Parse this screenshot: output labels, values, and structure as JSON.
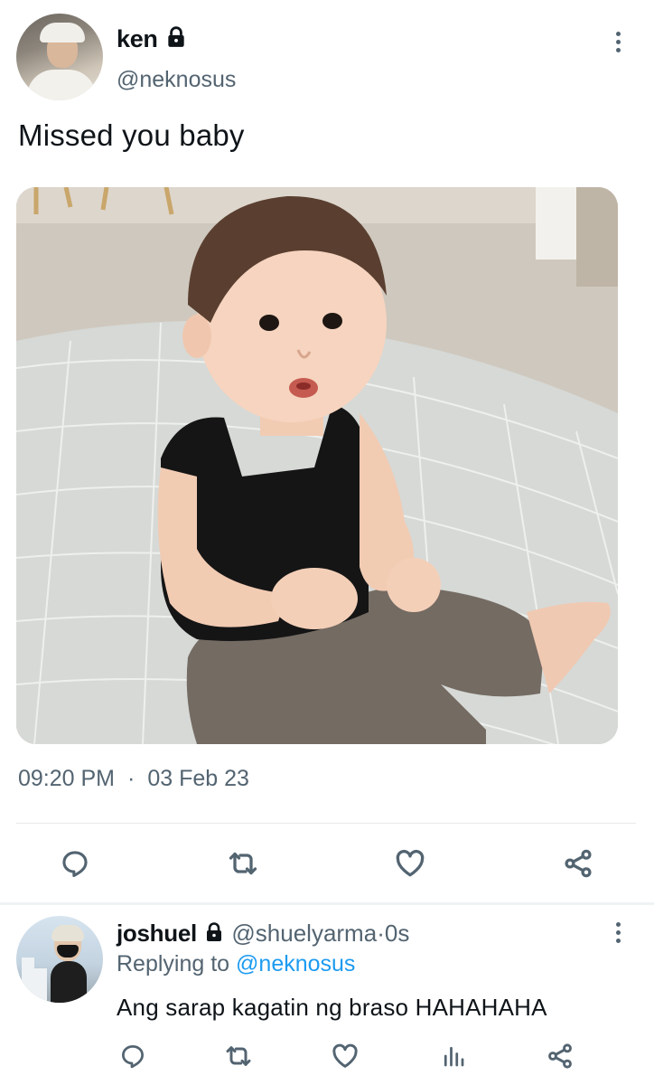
{
  "tweet": {
    "author": {
      "display_name": "ken",
      "handle": "@neknosus",
      "protected": true
    },
    "text": "Missed you baby",
    "time": "09:20 PM",
    "separator": "·",
    "date": "03 Feb 23",
    "actions": [
      "reply-icon",
      "retweet-icon",
      "like-icon",
      "share-icon"
    ]
  },
  "reply": {
    "author": {
      "display_name": "joshuel",
      "handle": "@shuelyarma",
      "protected": true
    },
    "separator": "·",
    "time_ago": "0s",
    "replying_prefix": "Replying to",
    "replying_to": "@neknosus",
    "text": "Ang sarap kagatin ng braso HAHAHAHA",
    "actions": [
      "reply-icon",
      "retweet-icon",
      "like-icon",
      "analytics-icon",
      "share-icon"
    ]
  },
  "colors": {
    "text_primary": "#0f1419",
    "text_secondary": "#536471",
    "link": "#1d9bf0",
    "divider": "#e7e9ea"
  }
}
